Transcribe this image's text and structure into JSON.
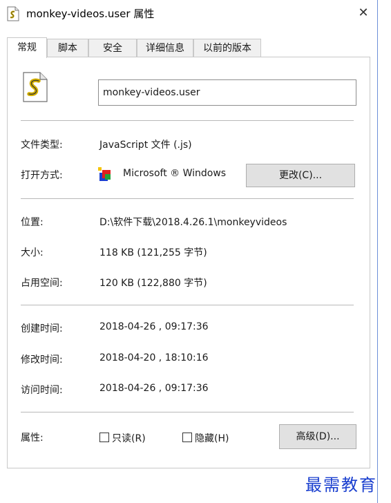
{
  "window": {
    "title": "monkey-videos.user 属性",
    "icon": "script-file-icon",
    "close_glyph": "✕"
  },
  "tabs": [
    {
      "label": "常规",
      "active": true
    },
    {
      "label": "脚本",
      "active": false
    },
    {
      "label": "安全",
      "active": false
    },
    {
      "label": "详细信息",
      "active": false
    },
    {
      "label": "以前的版本",
      "active": false
    }
  ],
  "general": {
    "file_name": "monkey-videos.user",
    "file_type_label": "文件类型:",
    "file_type_value": "JavaScript 文件 (.js)",
    "open_with_label": "打开方式:",
    "open_with_value": "Microsoft ® Windows",
    "change_button": "更改(C)...",
    "location_label": "位置:",
    "location_value": "D:\\软件下载\\2018.4.26.1\\monkeyvideos",
    "size_label": "大小:",
    "size_value": "118 KB (121,255 字节)",
    "disk_size_label": "占用空间:",
    "disk_size_value": "120 KB (122,880 字节)",
    "created_label": "创建时间:",
    "created_value": "2018-04-26 , 09:17:36",
    "modified_label": "修改时间:",
    "modified_value": "2018-04-20 , 18:10:16",
    "accessed_label": "访问时间:",
    "accessed_value": "2018-04-26 , 09:17:36",
    "attributes_label": "属性:",
    "readonly_label": "只读(R)",
    "readonly_checked": false,
    "hidden_label": "隐藏(H)",
    "hidden_checked": false,
    "advanced_button": "高级(D)..."
  },
  "watermark": "最需教育"
}
